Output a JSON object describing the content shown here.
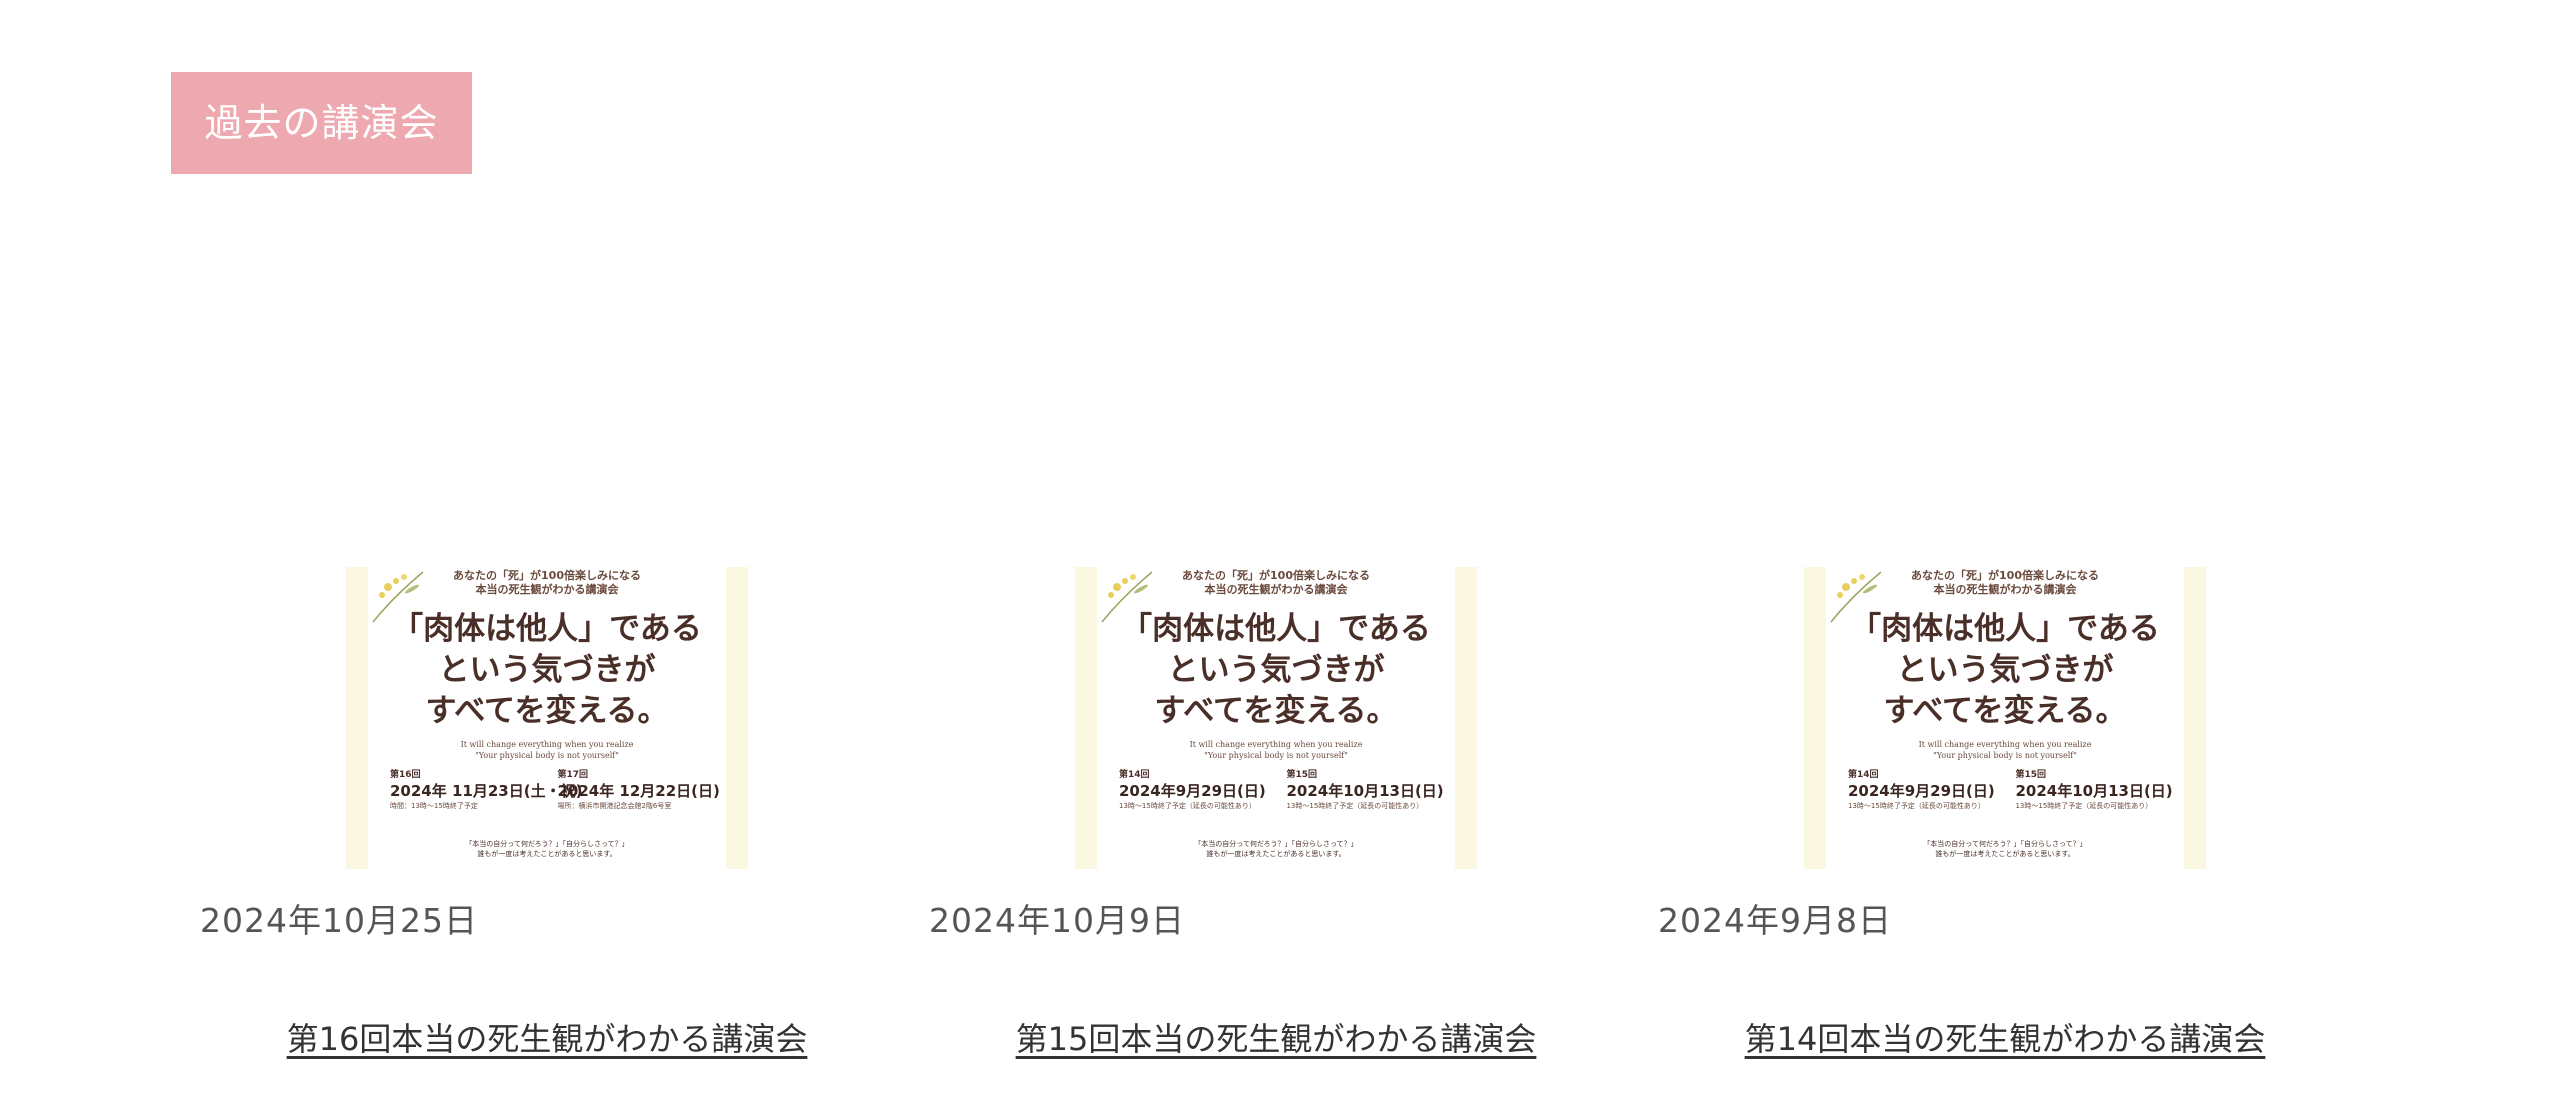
{
  "section": {
    "title": "過去の講演会"
  },
  "flyer": {
    "tagline": "あなたの「死」が100倍楽しみになる",
    "subtitle": "本当の死生観がわかる講演会",
    "headline": "「肉体は他人」である\nという気づきが\nすべてを変える。",
    "english": "It will change everything when you realize\n\"Your physical body is not yourself\"",
    "footer": "「本当の自分って何だろう？」「自分らしさって？」\n誰もが一度は考えたことがあると思います。"
  },
  "cards": [
    {
      "date": "2024年10月25日",
      "title": "第16回本当の死生観がわかる講演会",
      "flyer": {
        "left_label": "第16回",
        "left_date": "2024年 11月23日(土・祝)",
        "left_note": "時間：13時〜15時終了予定",
        "right_label": "第17回",
        "right_date": "2024年 12月22日(日)",
        "right_note": "場所：横浜市開港記念会館2階6号室"
      }
    },
    {
      "date": "2024年10月9日",
      "title": "第15回本当の死生観がわかる講演会",
      "flyer": {
        "left_label": "第14回",
        "left_date": "2024年9月29日(日)",
        "left_note": "13時〜15時終了予定（延長の可能性あり）",
        "right_label": "第15回",
        "right_date": "2024年10月13日(日)",
        "right_note": "13時〜15時終了予定（延長の可能性あり）"
      }
    },
    {
      "date": "2024年9月8日",
      "title": "第14回本当の死生観がわかる講演会",
      "flyer": {
        "left_label": "第14回",
        "left_date": "2024年9月29日(日)",
        "left_note": "13時〜15時終了予定（延長の可能性あり）",
        "right_label": "第15回",
        "right_date": "2024年10月13日(日)",
        "right_note": "13時〜15時終了予定（延長の可能性あり）"
      }
    }
  ]
}
